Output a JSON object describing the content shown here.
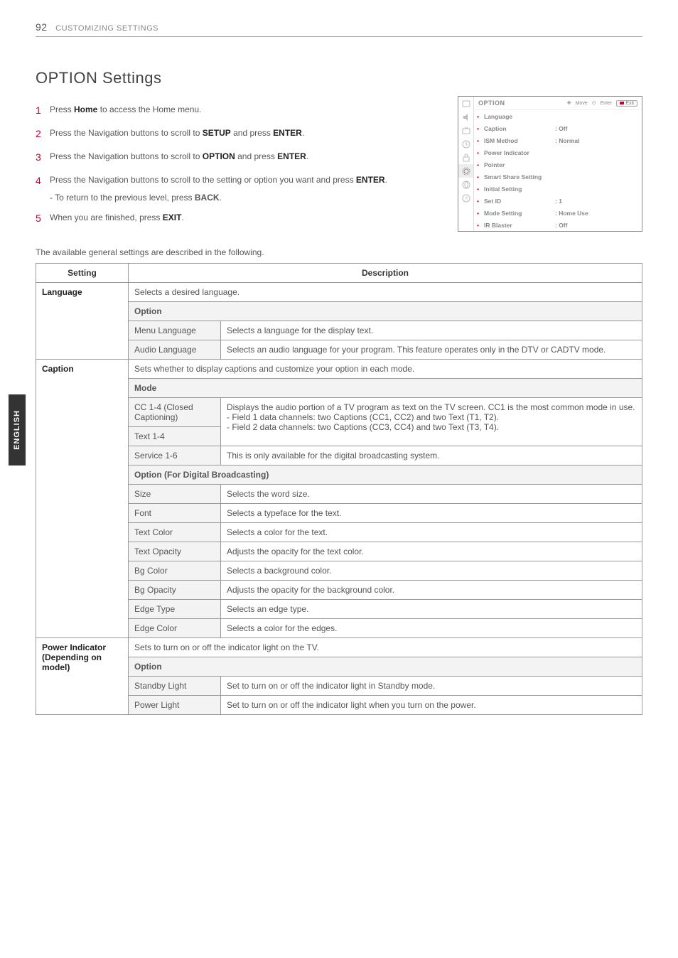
{
  "page": {
    "number": "92",
    "chapter": "CUSTOMIZING SETTINGS"
  },
  "lang_tab": "ENGLISH",
  "title": "OPTION Settings",
  "steps": [
    {
      "num": "1",
      "text": "Press ",
      "bold1": "Home",
      "text2": " to access the Home menu."
    },
    {
      "num": "2",
      "text": "Press the Navigation buttons to scroll to ",
      "bold1": "SETUP",
      "text2": " and press ",
      "bold2": "ENTER",
      "text3": "."
    },
    {
      "num": "3",
      "text": "Press the Navigation buttons to scroll to ",
      "bold1": "OPTION",
      "text2": " and press ",
      "bold2": "ENTER",
      "text3": "."
    },
    {
      "num": "4",
      "text": "Press the Navigation buttons to scroll to the setting or option you want and press ",
      "bold1": "ENTER",
      "text2": "."
    }
  ],
  "substep": "- To return to the previous level, press ",
  "substep_bold": "BACK",
  "substep_tail": ".",
  "step5": {
    "num": "5",
    "text": "When you are finished, press ",
    "bold1": "EXIT",
    "text2": "."
  },
  "intro": "The available general settings are described in the following.",
  "osd": {
    "title": "OPTION",
    "move": "Move",
    "enter": "Enter",
    "exit": "Exit",
    "items": [
      {
        "label": "Language",
        "val": ""
      },
      {
        "label": "Caption",
        "val": ": Off"
      },
      {
        "label": "ISM Method",
        "val": ": Normal"
      },
      {
        "label": "Power Indicator",
        "val": ""
      },
      {
        "label": "Pointer",
        "val": ""
      },
      {
        "label": "Smart Share Setting",
        "val": ""
      },
      {
        "label": "Initial Setting",
        "val": ""
      },
      {
        "label": "Set ID",
        "val": ": 1"
      },
      {
        "label": "Mode Setting",
        "val": ": Home Use"
      },
      {
        "label": "IR Blaster",
        "val": ": Off"
      }
    ]
  },
  "table": {
    "head": {
      "c1": "Setting",
      "c2": "Description"
    },
    "language": {
      "label": "Language",
      "desc": "Selects a desired language.",
      "subhead": "Option",
      "rows": [
        {
          "name": "Menu Language",
          "desc": "Selects a language for the display text."
        },
        {
          "name": "Audio Language",
          "desc": "Selects an audio language for your program. This feature operates only in the DTV or CADTV mode."
        }
      ]
    },
    "caption": {
      "label": "Caption",
      "desc": "Sets whether to display captions and customize your option in each mode.",
      "subhead1": "Mode",
      "mode_rows": {
        "cc_name": "CC 1-4 (Closed Captioning)",
        "text_name": "Text 1-4",
        "merged_desc_l1": "Displays the audio portion of a TV program as text on the TV screen. CC1 is the most common mode in use.",
        "merged_desc_l2": "- Field 1 data channels: two Captions (CC1, CC2) and two Text (T1, T2).",
        "merged_desc_l3": "- Field 2 data channels: two Captions (CC3, CC4) and two Text (T3, T4).",
        "service_name": "Service 1-6",
        "service_desc": "This is only available for the digital broadcasting system."
      },
      "subhead2": "Option (For Digital Broadcasting)",
      "opt_rows": [
        {
          "name": "Size",
          "desc": "Selects the word size."
        },
        {
          "name": "Font",
          "desc": "Selects a typeface for the text."
        },
        {
          "name": "Text Color",
          "desc": "Selects a color for the text."
        },
        {
          "name": "Text Opacity",
          "desc": "Adjusts the opacity for the text color."
        },
        {
          "name": "Bg Color",
          "desc": "Selects a background color."
        },
        {
          "name": "Bg Opacity",
          "desc": "Adjusts the opacity for the background color."
        },
        {
          "name": "Edge Type",
          "desc": "Selects an edge type."
        },
        {
          "name": "Edge Color",
          "desc": "Selects a color for the edges."
        }
      ]
    },
    "power": {
      "label_l1": "Power Indicator",
      "label_l2": "(Depending on model)",
      "desc": "Sets to turn on or off the indicator light on the TV.",
      "subhead": "Option",
      "rows": [
        {
          "name": "Standby Light",
          "desc": "Set to turn on or off the indicator light in Standby mode."
        },
        {
          "name": "Power Light",
          "desc": "Set to turn on or off the indicator light when you turn on the power."
        }
      ]
    }
  }
}
